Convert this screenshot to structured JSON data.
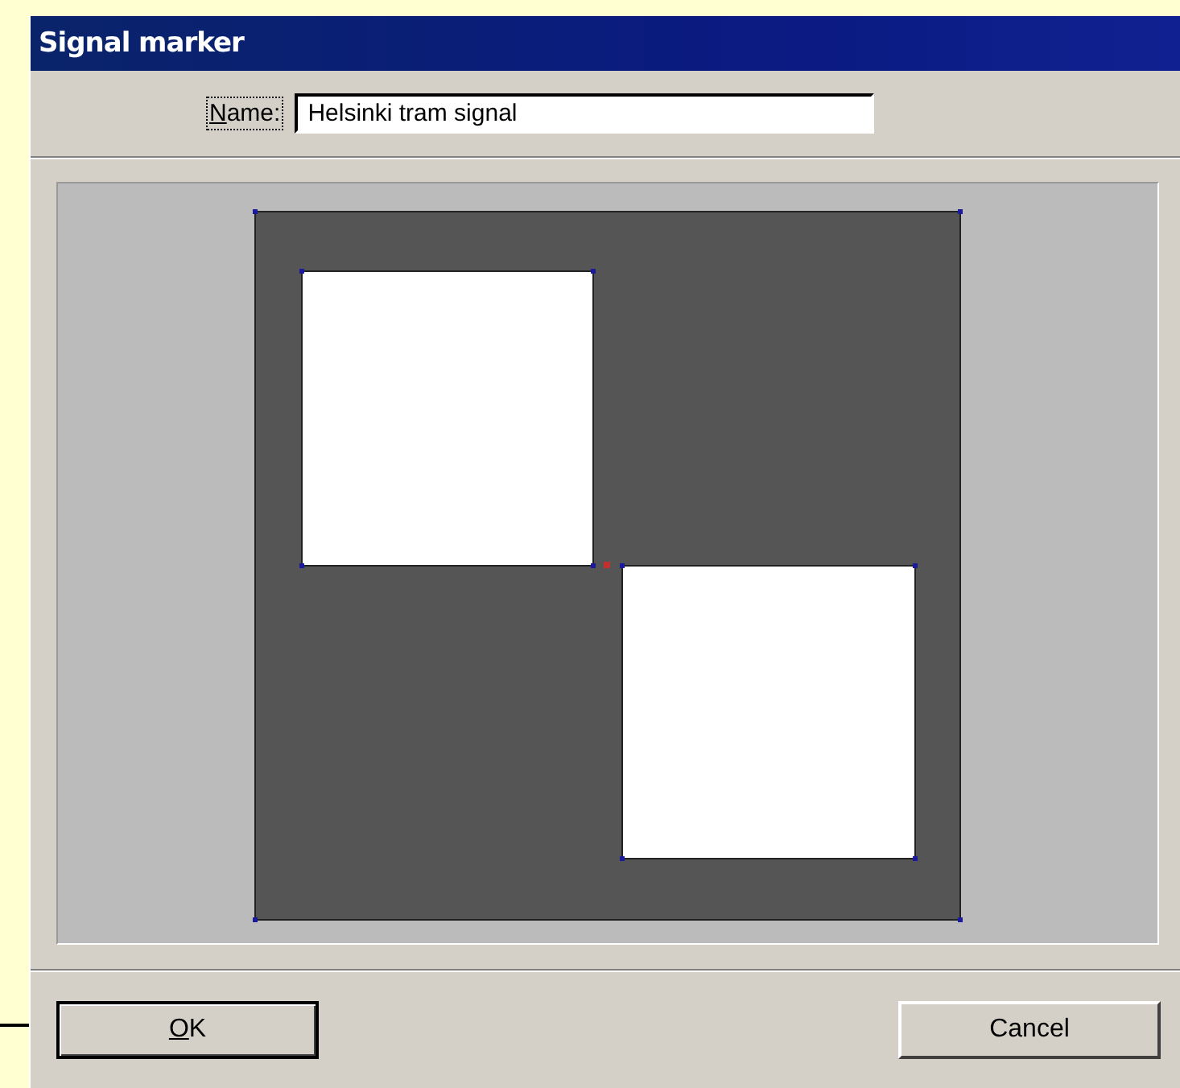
{
  "window": {
    "title": "Signal marker"
  },
  "name_field": {
    "label": "Name:",
    "value": "Helsinki tram signal"
  },
  "buttons": [
    {
      "label": "OK",
      "default": true
    },
    {
      "label": "Cancel",
      "default": false
    }
  ]
}
